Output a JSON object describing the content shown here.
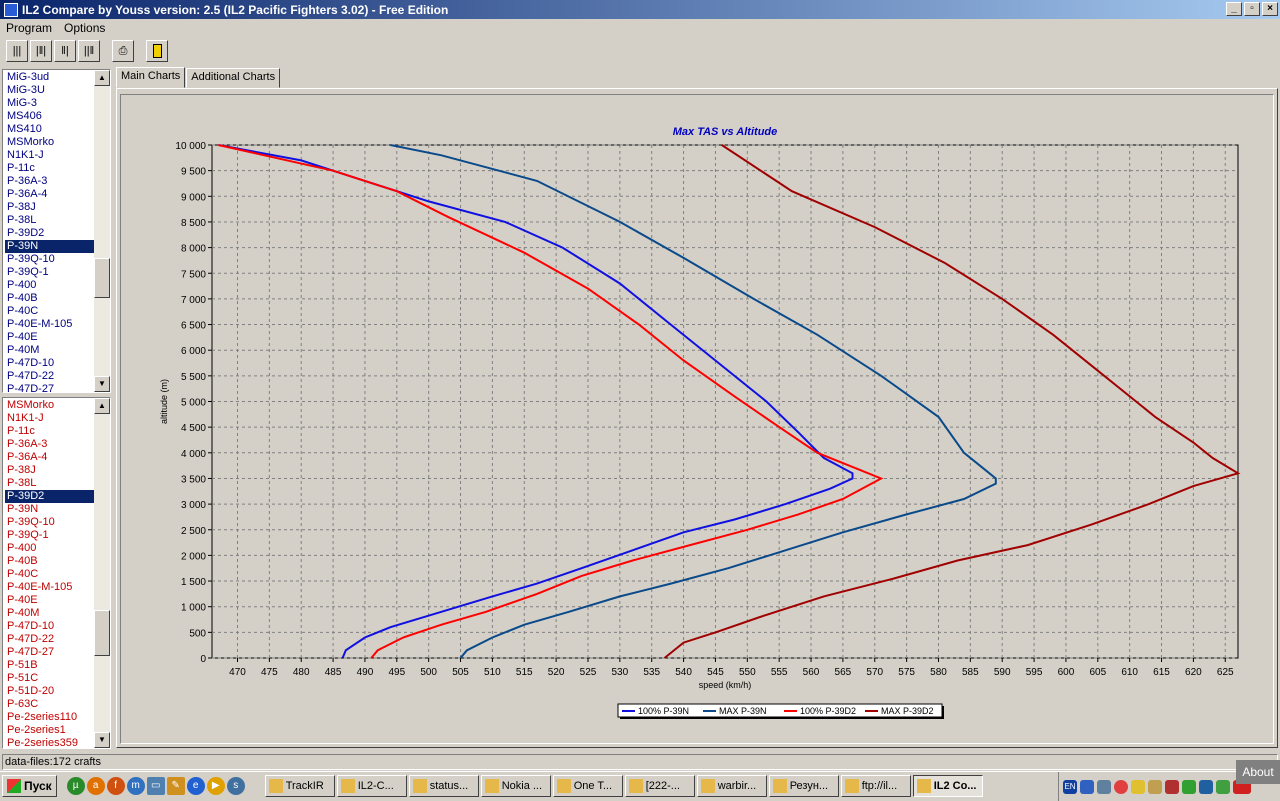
{
  "window": {
    "title": "IL2 Compare by Youss  version: 2.5 (IL2 Pacific Fighters 3.02)  - Free Edition"
  },
  "menu": [
    "Program",
    "Options"
  ],
  "list_top": {
    "items": [
      "MiG-3ud",
      "MiG-3U",
      "MiG-3",
      "MS406",
      "MS410",
      "MSMorko",
      "N1K1-J",
      "P-11c",
      "P-36A-3",
      "P-36A-4",
      "P-38J",
      "P-38L",
      "P-39D2",
      "P-39N",
      "P-39Q-10",
      "P-39Q-1",
      "P-400",
      "P-40B",
      "P-40C",
      "P-40E-M-105",
      "P-40E",
      "P-40M",
      "P-47D-10",
      "P-47D-22",
      "P-47D-27"
    ],
    "selected": "P-39N"
  },
  "list_bottom": {
    "items": [
      "MSMorko",
      "N1K1-J",
      "P-11c",
      "P-36A-3",
      "P-36A-4",
      "P-38J",
      "P-38L",
      "P-39D2",
      "P-39N",
      "P-39Q-10",
      "P-39Q-1",
      "P-400",
      "P-40B",
      "P-40C",
      "P-40E-M-105",
      "P-40E",
      "P-40M",
      "P-47D-10",
      "P-47D-22",
      "P-47D-27",
      "P-51B",
      "P-51C",
      "P-51D-20",
      "P-63C",
      "Pe-2series110",
      "Pe-2series1",
      "Pe-2series359"
    ],
    "selected": "P-39D2"
  },
  "tabs": {
    "main": "Main Charts",
    "additional": "Additional Charts"
  },
  "status": {
    "text": "data-files:172 crafts"
  },
  "taskbar": {
    "start": "Пуск",
    "items": [
      "TrackIR",
      "IL2-C...",
      "status...",
      "Nokia ...",
      "One T...",
      "[222-...",
      "warbir...",
      "Резун...",
      "ftp://il...",
      "IL2 Co..."
    ],
    "active": "IL2 Co...",
    "about": "About",
    "lang": "EN"
  },
  "chart_data": {
    "type": "line",
    "title": "Max TAS vs Altitude",
    "xlabel": "speed (km/h)",
    "ylabel": "altitude (m)",
    "xlim": [
      466,
      627
    ],
    "ylim": [
      0,
      10000
    ],
    "xticks": [
      470,
      475,
      480,
      485,
      490,
      495,
      500,
      505,
      510,
      515,
      520,
      525,
      530,
      535,
      540,
      545,
      550,
      555,
      560,
      565,
      570,
      575,
      580,
      585,
      590,
      595,
      600,
      605,
      610,
      615,
      620,
      625
    ],
    "yticks": [
      0,
      500,
      1000,
      1500,
      2000,
      2500,
      3000,
      3500,
      4000,
      4500,
      5000,
      5500,
      6000,
      6500,
      7000,
      7500,
      8000,
      8500,
      9000,
      9500,
      10000
    ],
    "ytick_labels": [
      "0",
      "500",
      "1 000",
      "1 500",
      "2 000",
      "2 500",
      "3 000",
      "3 500",
      "4 000",
      "4 500",
      "5 000",
      "5 500",
      "6 000",
      "6 500",
      "7 000",
      "7 500",
      "8 000",
      "8 500",
      "9 000",
      "9 500",
      "10 000"
    ],
    "grid": true,
    "legend_position": "bottom",
    "series": [
      {
        "name": "100% P-39N",
        "color": "#1010e0",
        "points": [
          [
            486.5,
            0
          ],
          [
            487,
            150
          ],
          [
            490,
            400
          ],
          [
            494,
            600
          ],
          [
            502,
            900
          ],
          [
            510,
            1200
          ],
          [
            517,
            1450
          ],
          [
            524,
            1750
          ],
          [
            532,
            2100
          ],
          [
            540,
            2450
          ],
          [
            548,
            2700
          ],
          [
            556,
            3000
          ],
          [
            563,
            3300
          ],
          [
            566.5,
            3500
          ],
          [
            566.5,
            3600
          ],
          [
            562,
            3900
          ],
          [
            558,
            4400
          ],
          [
            553,
            5000
          ],
          [
            546,
            5700
          ],
          [
            538,
            6500
          ],
          [
            530,
            7300
          ],
          [
            521,
            8000
          ],
          [
            512,
            8500
          ],
          [
            500,
            8900
          ],
          [
            490,
            9300
          ],
          [
            480,
            9700
          ],
          [
            467,
            10000
          ]
        ]
      },
      {
        "name": "MAX P-39N",
        "color": "#0a4a8a",
        "points": [
          [
            505,
            0
          ],
          [
            506,
            150
          ],
          [
            510,
            400
          ],
          [
            515,
            650
          ],
          [
            522,
            900
          ],
          [
            530,
            1200
          ],
          [
            538,
            1450
          ],
          [
            547,
            1750
          ],
          [
            556,
            2100
          ],
          [
            565,
            2450
          ],
          [
            575,
            2800
          ],
          [
            584,
            3100
          ],
          [
            589,
            3400
          ],
          [
            589,
            3500
          ],
          [
            587,
            3700
          ],
          [
            584,
            4000
          ],
          [
            580,
            4700
          ],
          [
            571,
            5500
          ],
          [
            561,
            6300
          ],
          [
            551,
            7000
          ],
          [
            540,
            7800
          ],
          [
            530,
            8500
          ],
          [
            517,
            9300
          ],
          [
            502,
            9800
          ],
          [
            494,
            10000
          ]
        ]
      },
      {
        "name": "100% P-39D2",
        "color": "#ff0000",
        "points": [
          [
            491,
            0
          ],
          [
            492,
            150
          ],
          [
            496,
            400
          ],
          [
            502,
            650
          ],
          [
            509,
            900
          ],
          [
            517,
            1250
          ],
          [
            524,
            1600
          ],
          [
            532,
            1900
          ],
          [
            541,
            2200
          ],
          [
            550,
            2500
          ],
          [
            558,
            2800
          ],
          [
            565,
            3100
          ],
          [
            571,
            3500
          ],
          [
            567,
            3700
          ],
          [
            561,
            4000
          ],
          [
            555,
            4500
          ],
          [
            548,
            5100
          ],
          [
            540,
            5800
          ],
          [
            533,
            6500
          ],
          [
            525,
            7200
          ],
          [
            515,
            7900
          ],
          [
            503,
            8600
          ],
          [
            495,
            9100
          ],
          [
            485,
            9500
          ],
          [
            467,
            10000
          ]
        ]
      },
      {
        "name": "MAX P-39D2",
        "color": "#a00000",
        "points": [
          [
            537,
            0
          ],
          [
            540,
            300
          ],
          [
            545,
            500
          ],
          [
            552,
            800
          ],
          [
            562,
            1200
          ],
          [
            573,
            1550
          ],
          [
            583,
            1900
          ],
          [
            594,
            2200
          ],
          [
            604,
            2600
          ],
          [
            613,
            3000
          ],
          [
            620,
            3350
          ],
          [
            627,
            3600
          ],
          [
            623,
            3900
          ],
          [
            620,
            4200
          ],
          [
            614,
            4700
          ],
          [
            606,
            5500
          ],
          [
            598,
            6300
          ],
          [
            590,
            7000
          ],
          [
            581,
            7700
          ],
          [
            570,
            8400
          ],
          [
            557,
            9100
          ],
          [
            546,
            10000
          ]
        ]
      }
    ]
  }
}
